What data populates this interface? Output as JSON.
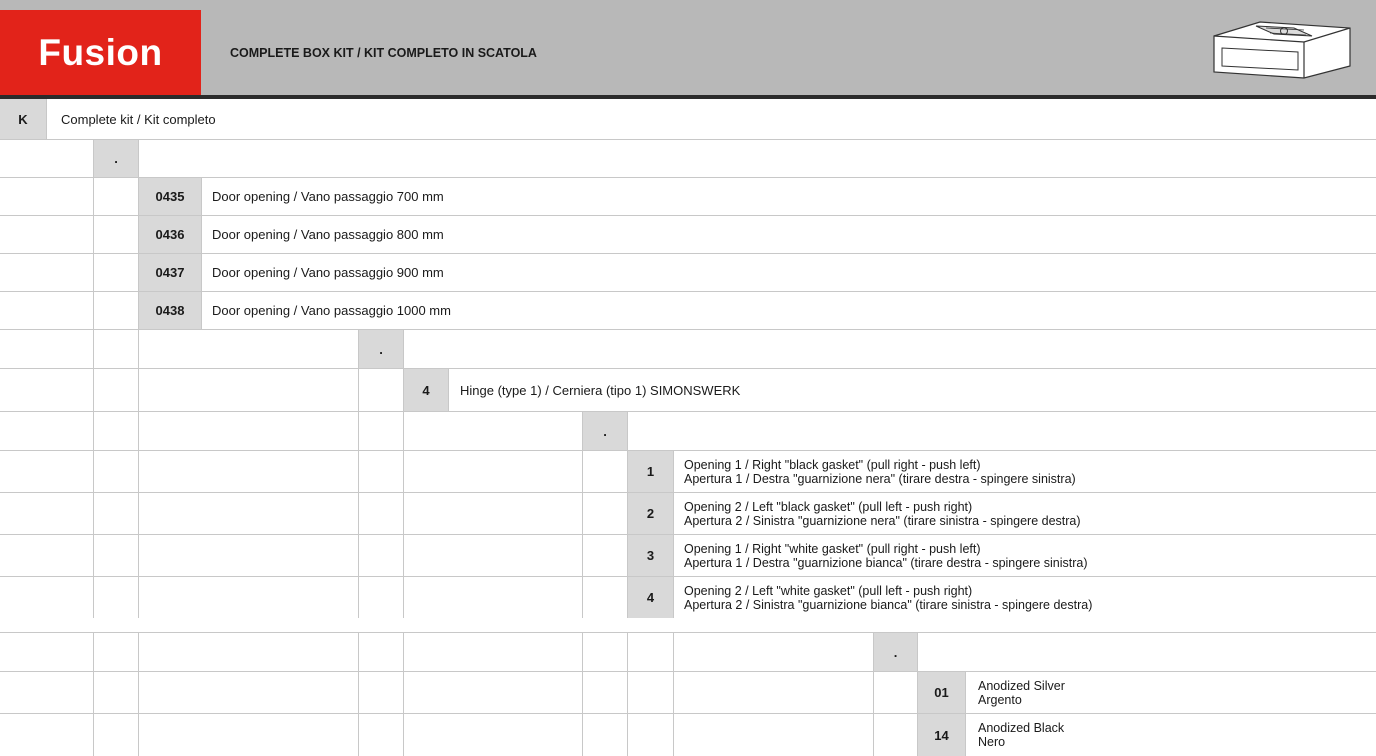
{
  "header": {
    "brand": "Fusion",
    "subtitle": "COMPLETE BOX KIT / KIT COMPLETO IN SCATOLA",
    "icon": "box-kit-icon"
  },
  "kit": {
    "code": "K",
    "label": "Complete kit / Kit completo"
  },
  "separator": ".",
  "openings": [
    {
      "code": "0435",
      "label": "Door opening / Vano passaggio 700 mm"
    },
    {
      "code": "0436",
      "label": "Door opening / Vano passaggio 800 mm"
    },
    {
      "code": "0437",
      "label": "Door opening / Vano passaggio 900 mm"
    },
    {
      "code": "0438",
      "label": "Door opening / Vano passaggio 1000 mm"
    }
  ],
  "hinge": {
    "code": "4",
    "label": "Hinge (type 1) / Cerniera (tipo 1) SIMONSWERK"
  },
  "directions": [
    {
      "code": "1",
      "line1": "Opening 1 / Right \"black gasket\" (pull right - push left)",
      "line2": "Apertura 1 / Destra \"guarnizione nera\" (tirare destra - spingere sinistra)"
    },
    {
      "code": "2",
      "line1": "Opening 2 / Left \"black gasket\" (pull left - push right)",
      "line2": "Apertura 2 / Sinistra \"guarnizione nera\" (tirare sinistra - spingere destra)"
    },
    {
      "code": "3",
      "line1": "Opening 1 / Right \"white gasket\" (pull right - push left)",
      "line2": "Apertura 1 / Destra \"guarnizione bianca\" (tirare destra - spingere sinistra)"
    },
    {
      "code": "4",
      "line1": "Opening 2 / Left \"white gasket\" (pull left - push right)",
      "line2": "Apertura 2 / Sinistra \"guarnizione bianca\" (tirare sinistra - spingere destra)"
    }
  ],
  "finishes": [
    {
      "code": "01",
      "line1": "Anodized Silver",
      "line2": "Argento"
    },
    {
      "code": "14",
      "line1": "Anodized Black",
      "line2": "Nero"
    }
  ],
  "colors": {
    "brand_red": "#e2231a",
    "header_gray": "#b8b8b8",
    "code_cell": "#d9d9d9"
  }
}
